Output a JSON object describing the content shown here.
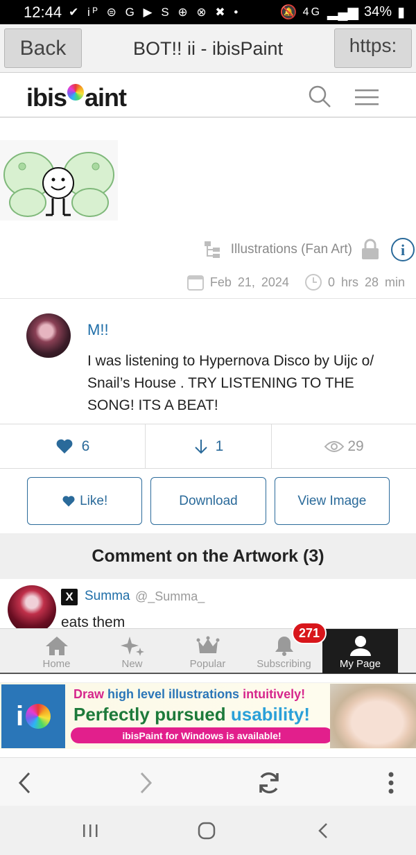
{
  "status_bar": {
    "time": "12:44",
    "icons_text": "✔ iᴾ ⊜ G ▶ S ⊕ ⊗ ✖ •",
    "network": "4G",
    "battery": "34%"
  },
  "titlebar": {
    "back_label": "Back",
    "title": "BOT!! ii - ibisPaint",
    "url_label": "https:"
  },
  "site": {
    "logo_pre": "ibis",
    "logo_post": "aint"
  },
  "artwork_meta": {
    "category": "Illustrations (Fan Art)",
    "date": "Feb 21, 2024",
    "duration": "0 hrs 28 min"
  },
  "post": {
    "author": "M!!",
    "text": "I was listening to Hypernova Disco by Uijc o/ Snail’s House . TRY LISTENING TO THE SONG! ITS A BEAT!"
  },
  "stats": {
    "likes": "6",
    "downloads": "1",
    "views": "29"
  },
  "actions": {
    "like": "Like!",
    "download": "Download",
    "view_image": "View Image"
  },
  "comments": {
    "header": "Comment on the Artwork (3)",
    "items": [
      {
        "x_label": "X",
        "name": "Summa",
        "handle": "@_Summa_",
        "text": "eats them"
      }
    ]
  },
  "tabs": [
    {
      "label": "Home",
      "icon": "home-icon"
    },
    {
      "label": "New",
      "icon": "sparkle-icon"
    },
    {
      "label": "Popular",
      "icon": "crown-icon"
    },
    {
      "label": "Subscribing",
      "icon": "bell-icon"
    },
    {
      "label": "My Page",
      "icon": "person-icon"
    }
  ],
  "notification_badge": "271",
  "ad": {
    "logo_text": "i",
    "line1_a": "Draw ",
    "line1_b": "high level illustrations",
    "line1_c": " intuitively!",
    "line2_a": "Perfectly pursued ",
    "line2_b": "usability!",
    "pill": "ibisPaint for Windows is available!"
  },
  "colors": {
    "accent_blue": "#2a6a9a",
    "link_blue": "#1f6ea8",
    "badge_red": "#d8161b",
    "ad_pink": "#e21f8c"
  }
}
